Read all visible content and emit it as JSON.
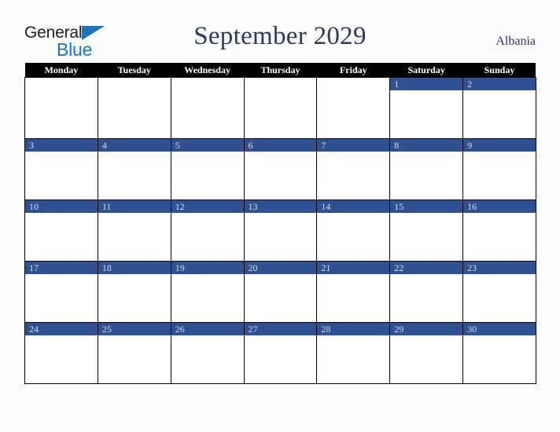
{
  "brand": {
    "name_part1": "General",
    "name_part2": "Blue",
    "triangle_icon": "blue-triangle-icon",
    "colors": {
      "dark_text": "#231f20",
      "blue": "#1b75bb"
    }
  },
  "header": {
    "title": "September 2029",
    "month": "September",
    "year": "2029",
    "country": "Albania"
  },
  "colors": {
    "page_background": "#fdfdfd",
    "header_row_background": "#000000",
    "header_row_text": "#ffffff",
    "day_band_background": "#2f5191",
    "day_band_text": "#d5dbe8",
    "title_text": "#2a3a63",
    "cell_background": "#ffffff",
    "grid_line": "#000000"
  },
  "calendar": {
    "weekday_headers": [
      "Monday",
      "Tuesday",
      "Wednesday",
      "Thursday",
      "Friday",
      "Saturday",
      "Sunday"
    ],
    "first_day_of_week": "Monday",
    "weeks": [
      [
        {
          "day": "",
          "empty": true
        },
        {
          "day": "",
          "empty": true
        },
        {
          "day": "",
          "empty": true
        },
        {
          "day": "",
          "empty": true
        },
        {
          "day": "",
          "empty": true
        },
        {
          "day": "1",
          "empty": false
        },
        {
          "day": "2",
          "empty": false
        }
      ],
      [
        {
          "day": "3",
          "empty": false
        },
        {
          "day": "4",
          "empty": false
        },
        {
          "day": "5",
          "empty": false
        },
        {
          "day": "6",
          "empty": false
        },
        {
          "day": "7",
          "empty": false
        },
        {
          "day": "8",
          "empty": false
        },
        {
          "day": "9",
          "empty": false
        }
      ],
      [
        {
          "day": "10",
          "empty": false
        },
        {
          "day": "11",
          "empty": false
        },
        {
          "day": "12",
          "empty": false
        },
        {
          "day": "13",
          "empty": false
        },
        {
          "day": "14",
          "empty": false
        },
        {
          "day": "15",
          "empty": false
        },
        {
          "day": "16",
          "empty": false
        }
      ],
      [
        {
          "day": "17",
          "empty": false
        },
        {
          "day": "18",
          "empty": false
        },
        {
          "day": "19",
          "empty": false
        },
        {
          "day": "20",
          "empty": false
        },
        {
          "day": "21",
          "empty": false
        },
        {
          "day": "22",
          "empty": false
        },
        {
          "day": "23",
          "empty": false
        }
      ],
      [
        {
          "day": "24",
          "empty": false
        },
        {
          "day": "25",
          "empty": false
        },
        {
          "day": "26",
          "empty": false
        },
        {
          "day": "27",
          "empty": false
        },
        {
          "day": "28",
          "empty": false
        },
        {
          "day": "29",
          "empty": false
        },
        {
          "day": "30",
          "empty": false
        }
      ]
    ]
  }
}
